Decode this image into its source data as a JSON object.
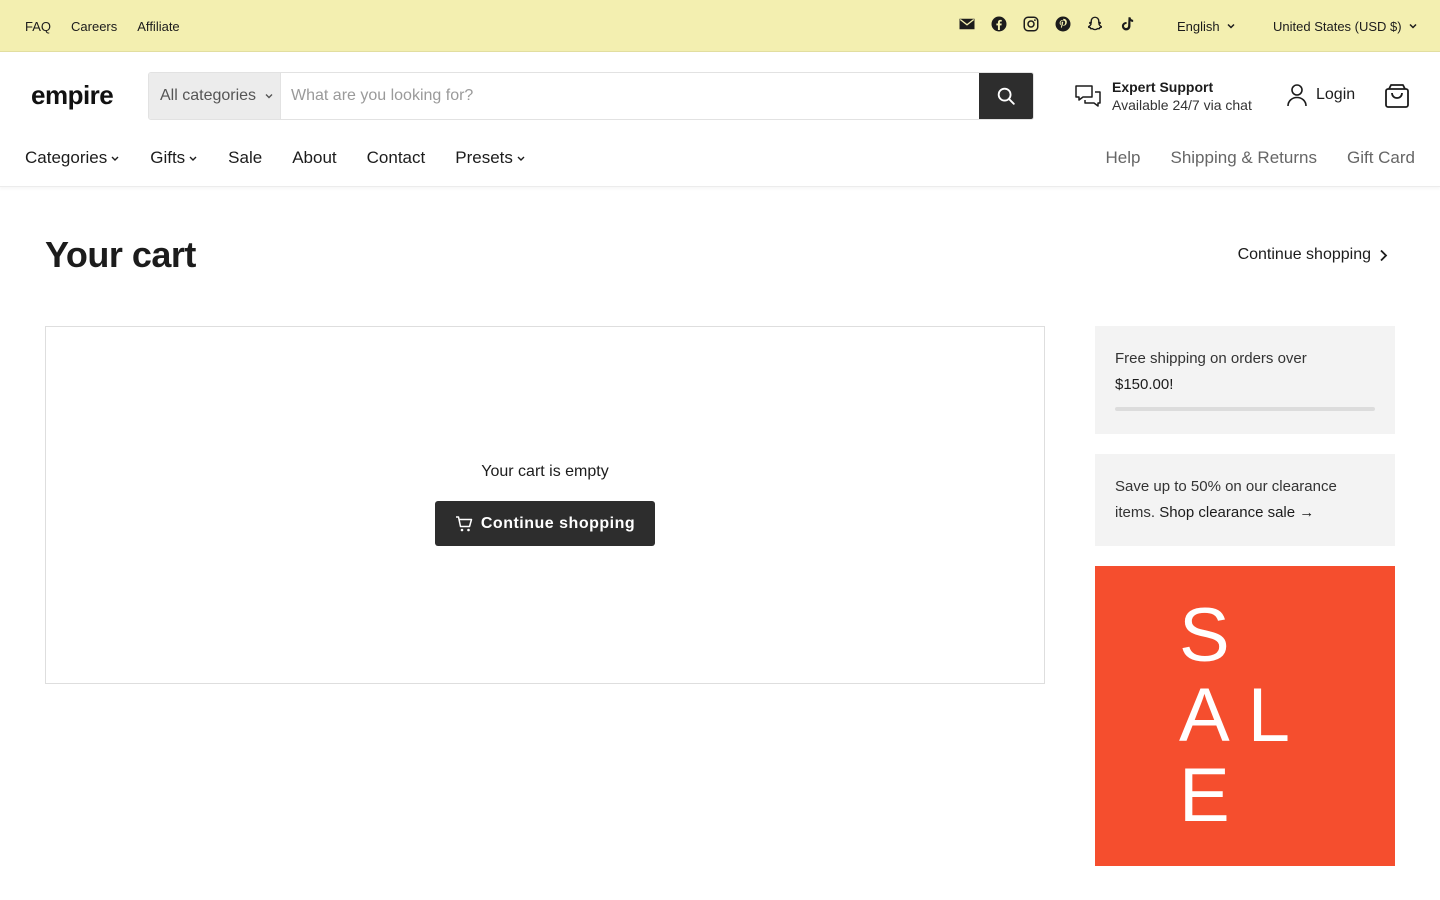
{
  "topbar": {
    "links": [
      "FAQ",
      "Careers",
      "Affiliate"
    ],
    "social_icons": [
      "email-icon",
      "facebook-icon",
      "instagram-icon",
      "pinterest-icon",
      "snapchat-icon",
      "tiktok-icon"
    ],
    "language": "English",
    "country": "United States (USD $)",
    "background": "#f3efb0"
  },
  "header": {
    "logo": "empire",
    "search": {
      "category": "All categories",
      "placeholder": "What are you looking for?"
    },
    "support": {
      "title": "Expert Support",
      "subtitle": "Available 24/7 via chat"
    },
    "login_label": "Login",
    "nav_left": [
      "Categories",
      "Gifts",
      "Sale",
      "About",
      "Contact",
      "Presets"
    ],
    "nav_right": [
      "Help",
      "Shipping & Returns",
      "Gift Card"
    ]
  },
  "main": {
    "title": "Your cart",
    "continue_link": "Continue shopping",
    "empty_text": "Your cart is empty",
    "continue_button": "Continue shopping"
  },
  "sidebar": {
    "shipping_text": "Free shipping on orders over",
    "shipping_amount": "$150.00!",
    "shipping_progress": 0,
    "clearance_text": "Save up to 50% on our clearance items.",
    "clearance_link": "Shop clearance sale →",
    "sale_banner": "SALE",
    "sale_color": "#f54e2e"
  },
  "colors": {
    "dark_button": "#2d2d2d",
    "panel": "#f3f3f3"
  }
}
